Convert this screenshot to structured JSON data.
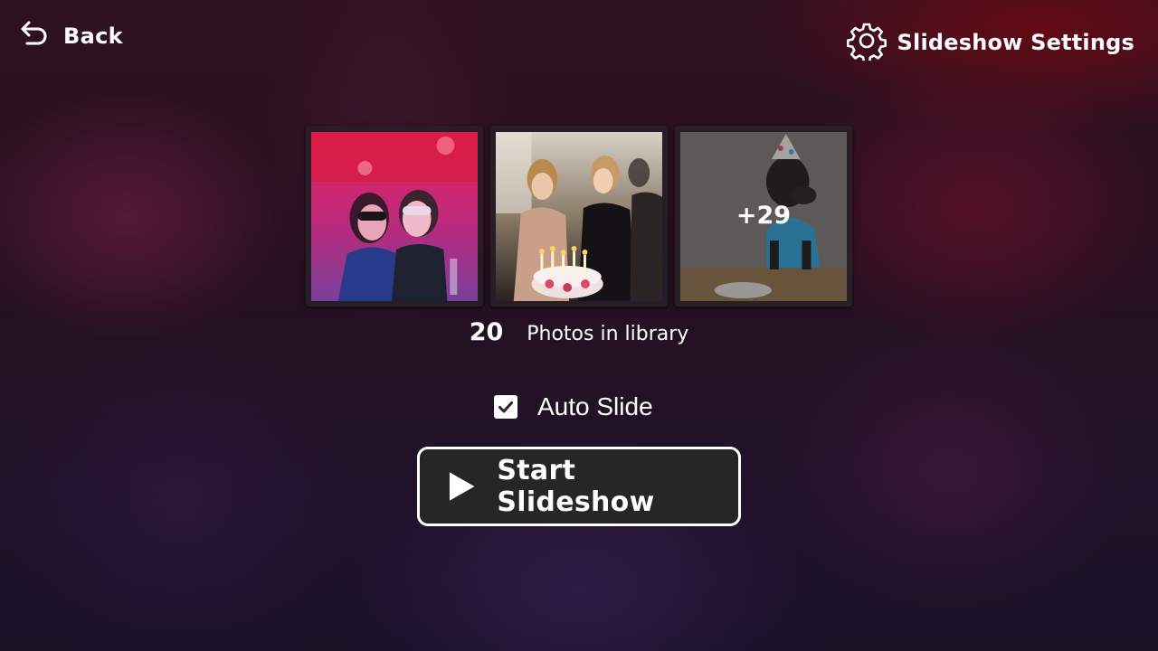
{
  "topbar": {
    "back_label": "Back",
    "settings_label": "Slideshow Settings"
  },
  "thumbnails": [
    {
      "name": "party-masks-photo"
    },
    {
      "name": "birthday-cake-photo"
    },
    {
      "name": "dog-party-hat-photo",
      "more_label": "+29"
    }
  ],
  "library": {
    "count": "20",
    "label": "Photos in library"
  },
  "auto_slide": {
    "label": "Auto Slide",
    "checked": true
  },
  "start_button": {
    "label": "Start Slideshow"
  },
  "icons": {
    "back": "undo-arrow-icon",
    "settings": "gear-icon",
    "checkbox": "checkmark-icon",
    "start": "play-icon"
  },
  "colors": {
    "button_bg": "#262626",
    "text": "#ffffff"
  }
}
